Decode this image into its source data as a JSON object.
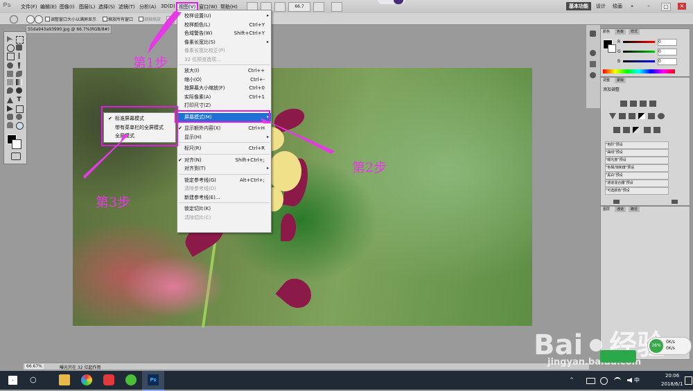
{
  "menubar": {
    "logo": "Ps",
    "items": [
      "文件(F)",
      "编辑(E)",
      "图像(I)",
      "图层(L)",
      "选择(S)",
      "滤镜(T)",
      "分析(A)",
      "3D(D)",
      "视图(V)",
      "窗口(W)",
      "帮助(H)"
    ],
    "zoom_value": "66.7",
    "workspaces": [
      "基本功能",
      "设计",
      "绘画"
    ],
    "more": "»"
  },
  "optionsbar": {
    "resize_windows": "调整窗口大小以满屏显示",
    "zoom_all": "缩放所有窗口",
    "scrubby": "细微缩放",
    "actual": "实"
  },
  "document": {
    "tab_title": "55da943a93990.jpg @ 66.7%(RGB/8#)",
    "close": "×"
  },
  "status": {
    "zoom": "66.67%",
    "info": "曝光只在 32 位起作用"
  },
  "view_menu": {
    "items": [
      {
        "label": "校样设置(U)",
        "shortcut": "",
        "arrow": true,
        "disabled": false
      },
      {
        "label": "校样颜色(L)",
        "shortcut": "Ctrl+Y",
        "disabled": false
      },
      {
        "label": "色域警告(W)",
        "shortcut": "Shift+Ctrl+Y",
        "disabled": false
      },
      {
        "label": "像素长宽比(S)",
        "shortcut": "",
        "arrow": true,
        "disabled": false
      },
      {
        "label": "像素长宽比校正(P)",
        "shortcut": "",
        "disabled": true
      },
      {
        "label": "32 位预览选项...",
        "shortcut": "",
        "disabled": true
      },
      {
        "sep": true
      },
      {
        "label": "放大(I)",
        "shortcut": "Ctrl++",
        "disabled": false
      },
      {
        "label": "缩小(O)",
        "shortcut": "Ctrl+-",
        "disabled": false
      },
      {
        "label": "按屏幕大小缩放(F)",
        "shortcut": "Ctrl+0",
        "disabled": false
      },
      {
        "label": "实际像素(A)",
        "shortcut": "Ctrl+1",
        "disabled": false
      },
      {
        "label": "打印尺寸(Z)",
        "shortcut": "",
        "disabled": false
      },
      {
        "sep": true
      },
      {
        "label": "屏幕模式(M)",
        "shortcut": "",
        "arrow": true,
        "highlighted": true
      },
      {
        "sep": true
      },
      {
        "label": "显示额外内容(X)",
        "shortcut": "Ctrl+H",
        "checked": true
      },
      {
        "label": "显示(H)",
        "shortcut": "",
        "arrow": true
      },
      {
        "sep": true
      },
      {
        "label": "标尺(R)",
        "shortcut": "Ctrl+R"
      },
      {
        "sep": true
      },
      {
        "label": "对齐(N)",
        "shortcut": "Shift+Ctrl+;",
        "checked": true
      },
      {
        "label": "对齐到(T)",
        "shortcut": "",
        "arrow": true
      },
      {
        "sep": true
      },
      {
        "label": "锁定参考线(G)",
        "shortcut": "Alt+Ctrl+;"
      },
      {
        "label": "清除参考线(D)",
        "shortcut": "",
        "disabled": true
      },
      {
        "label": "新建参考线(E)...",
        "shortcut": ""
      },
      {
        "sep": true
      },
      {
        "label": "锁定切片(K)",
        "shortcut": ""
      },
      {
        "label": "清除切片(C)",
        "shortcut": "",
        "disabled": true
      }
    ]
  },
  "screen_mode_submenu": {
    "items": [
      {
        "label": "标准屏幕模式",
        "checked": true
      },
      {
        "label": "带有菜单栏的全屏模式",
        "checked": false
      },
      {
        "label": "全屏模式",
        "checked": false
      }
    ]
  },
  "annotations": {
    "step1": "第1步",
    "step2": "第2步",
    "step3": "第3步",
    "color": "#e63ae6"
  },
  "color_panel": {
    "tabs": [
      "颜色",
      "色板",
      "样式"
    ],
    "channels": [
      {
        "name": "R",
        "value": "0"
      },
      {
        "name": "G",
        "value": "0"
      },
      {
        "name": "B",
        "value": "0"
      }
    ]
  },
  "adjustments_panel": {
    "tabs": [
      "调整",
      "蒙版"
    ],
    "title": "添加调整",
    "presets": [
      "\"色阶\"预设",
      "\"曲线\"预设",
      "\"曝光度\"预设",
      "\"色相/饱和度\"预设",
      "\"黑白\"预设",
      "\"通道混合器\"预设",
      "\"可选颜色\"预设"
    ]
  },
  "layers_panel": {
    "tabs": [
      "图层",
      "通道",
      "路径"
    ]
  },
  "taskbar": {
    "time": "20:06",
    "date": "2018/6/1",
    "search": "○"
  },
  "watermark": {
    "brand": "Bai",
    "brand2": "经验",
    "url": "jingyan.baidu.com"
  },
  "net_widget": {
    "up": "0K/s",
    "down": "0K/s",
    "speed": "26%"
  }
}
